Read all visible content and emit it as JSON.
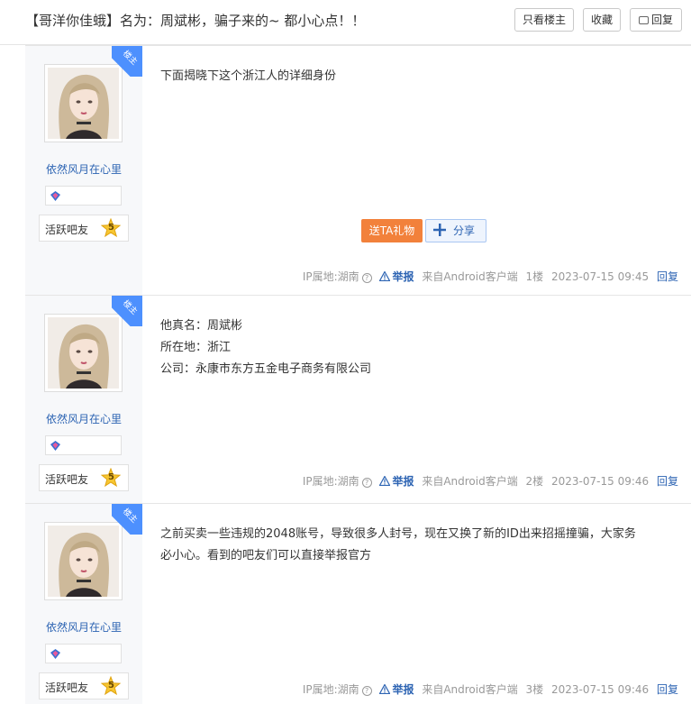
{
  "header": {
    "title": "【哥洋你佳蛾】名为：周斌彬，骗子来的~ 都小心点！！",
    "only_host_label": "只看楼主",
    "favorite_label": "收藏",
    "reply_label": "回复"
  },
  "common": {
    "host_tag": "楼主",
    "username": "依然风月在心里",
    "level_title": "活跃吧友",
    "level_num": "5",
    "gift_label": "送TA礼物",
    "share_label": "分享",
    "ip_label": "IP属地:湖南",
    "report_label": "举报",
    "reply_link": "回复"
  },
  "posts": [
    {
      "lines": [
        "下面揭晓下这个浙江人的详细身份"
      ],
      "source": "来自Android客户端",
      "floor": "1楼",
      "time": "2023-07-15 09:45"
    },
    {
      "lines": [
        "他真名：周斌彬",
        "所在地：浙江",
        "公司：永康市东方五金电子商务有限公司"
      ],
      "source": "来自Android客户端",
      "floor": "2楼",
      "time": "2023-07-15 09:46"
    },
    {
      "lines": [
        "之前买卖一些违规的2048账号，导致很多人封号，现在又换了新的ID出来招摇撞骗，大家务",
        "必小心。看到的吧友们可以直接举报官方"
      ],
      "source": "来自Android客户端",
      "floor": "3楼",
      "time": "2023-07-15 09:46"
    }
  ]
}
